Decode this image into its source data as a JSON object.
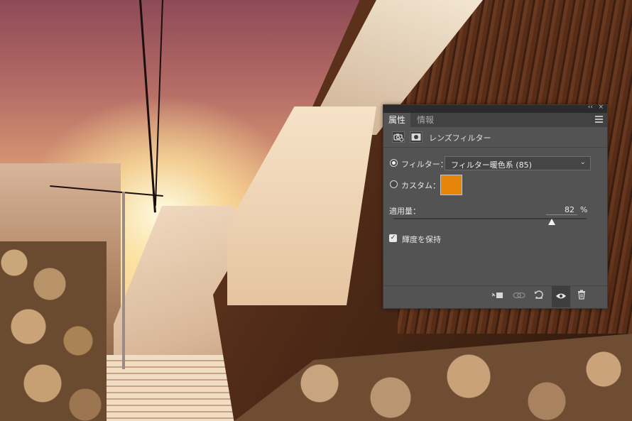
{
  "panel": {
    "titlebar": {
      "collapse_glyph": "‹‹",
      "close_glyph": "×"
    },
    "tabs": [
      {
        "label": "属性",
        "active": true
      },
      {
        "label": "情報",
        "active": false
      }
    ],
    "header_title": "レンズフィルター",
    "filter_option": {
      "label": "フィルター：",
      "selected_value": "フィルター暖色系 (85)",
      "checked": true
    },
    "custom_option": {
      "label": "カスタム：",
      "checked": false,
      "color": "#e5860b"
    },
    "density": {
      "label": "適用量：",
      "value": "82",
      "unit": "%",
      "fraction": 0.82
    },
    "preserve_luminosity": {
      "label": "輝度を保持",
      "checked": true
    },
    "colors": {
      "panel_bg": "#535353",
      "tab_bar": "#424242",
      "swatch": "#e5860b"
    }
  },
  "icons": {
    "panel_menu": "hamburger-menu-icon",
    "adjustment_type": "camera-filter-icon",
    "mask": "mask-icon",
    "footer": [
      "clip-to-layer-icon",
      "view-previous-state-icon",
      "reset-icon",
      "visibility-eye-icon",
      "trash-icon"
    ]
  }
}
